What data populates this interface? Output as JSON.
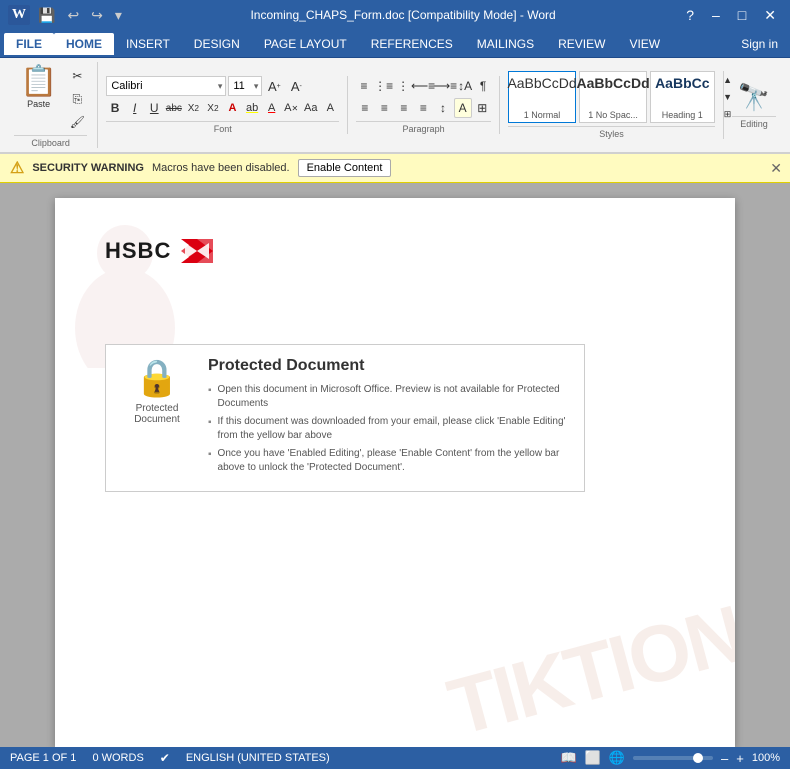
{
  "titlebar": {
    "title": "Incoming_CHAPS_Form.doc [Compatibility Mode] - Word",
    "help_icon": "?",
    "minimize": "–",
    "maximize": "□",
    "close": "✕"
  },
  "menubar": {
    "tabs": [
      "FILE",
      "HOME",
      "INSERT",
      "DESIGN",
      "PAGE LAYOUT",
      "REFERENCES",
      "MAILINGS",
      "REVIEW",
      "VIEW"
    ],
    "active": "HOME",
    "signin": "Sign in"
  },
  "ribbon": {
    "clipboard": {
      "label": "Clipboard",
      "paste_label": "Paste"
    },
    "font": {
      "label": "Font",
      "font_name": "Calibri",
      "font_size": "11",
      "bold": "B",
      "italic": "I",
      "underline": "U",
      "strikethrough": "abc",
      "subscript": "X₂",
      "superscript": "X²"
    },
    "paragraph": {
      "label": "Paragraph"
    },
    "styles": {
      "label": "Styles",
      "items": [
        {
          "preview": "AaBbCcDd",
          "label": "1 Normal",
          "type": "normal"
        },
        {
          "preview": "AaBbCcDd",
          "label": "1 No Spac...",
          "type": "nospace"
        },
        {
          "preview": "AaBbCc",
          "label": "Heading 1",
          "type": "heading"
        }
      ]
    },
    "editing": {
      "label": "Editing"
    }
  },
  "security": {
    "warning_bold": "SECURITY WARNING",
    "warning_text": "Macros have been disabled.",
    "button": "Enable Content",
    "close": "✕"
  },
  "document": {
    "hsbc_name": "HSBC",
    "protected_title": "Protected Document",
    "protected_items": [
      "Open this document in Microsoft Office. Preview is not available for Protected Documents",
      "If this document was downloaded from your email, please click 'Enable Editing' from the yellow bar above",
      "Once you have 'Enabled Editing', please 'Enable Content' from the yellow bar above to unlock the 'Protected Document'."
    ],
    "protected_icon_label": "Protected\nDocument",
    "watermark": "TIKTION"
  },
  "statusbar": {
    "page": "PAGE 1 OF 1",
    "words": "0 WORDS",
    "language": "ENGLISH (UNITED STATES)",
    "zoom": "100%"
  }
}
